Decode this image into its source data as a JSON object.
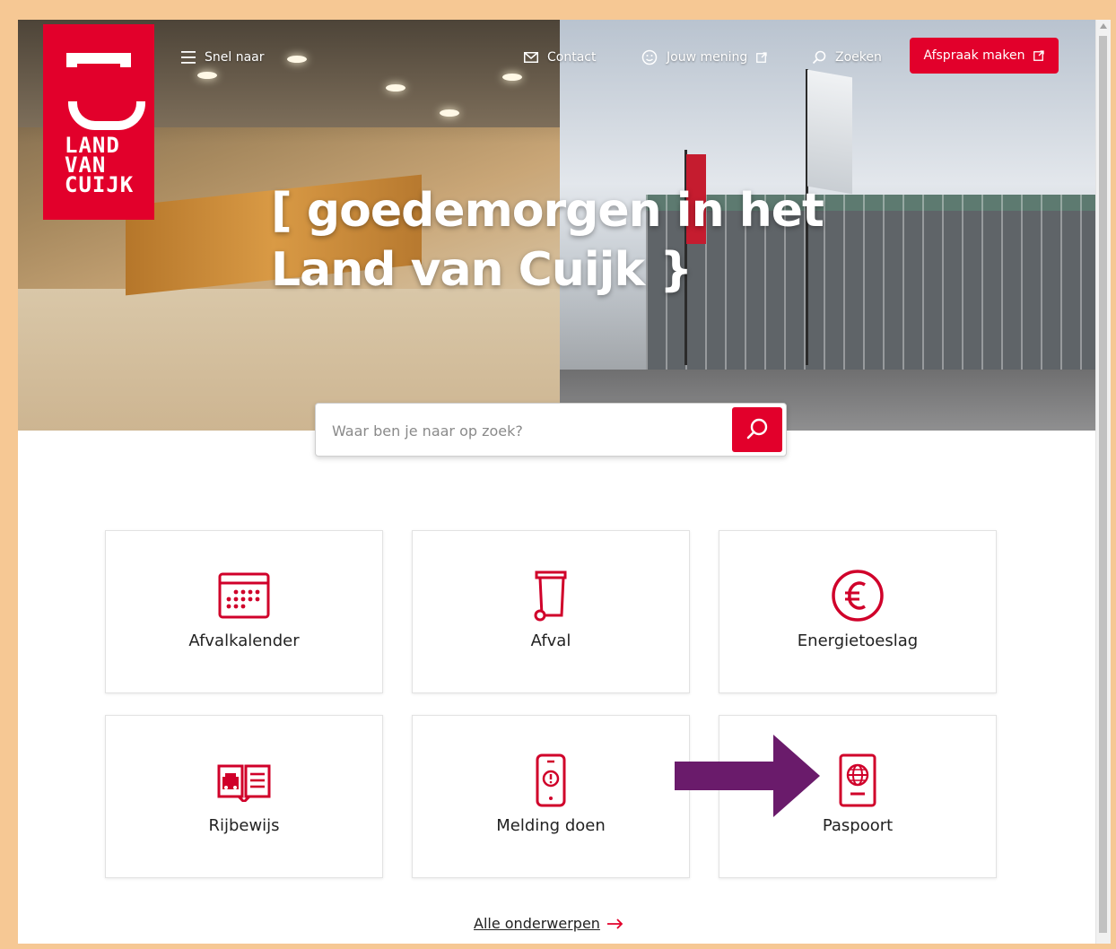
{
  "header": {
    "menu_label": "Snel naar",
    "contact_label": "Contact",
    "feedback_label": "Jouw mening",
    "search_label": "Zoeken",
    "cta_label": "Afspraak maken"
  },
  "logo": {
    "line1": "LAND",
    "line2": "VAN",
    "line3": "CUIJK"
  },
  "hero": {
    "title_line1": "[ goedemorgen in het",
    "title_line2": "Land van Cuijk }"
  },
  "search": {
    "placeholder": "Waar ben je naar op zoek?"
  },
  "tiles": [
    {
      "label": "Afvalkalender",
      "icon": "calendar-icon"
    },
    {
      "label": "Afval",
      "icon": "waste-bin-icon"
    },
    {
      "label": "Energietoeslag",
      "icon": "euro-icon"
    },
    {
      "label": "Rijbewijs",
      "icon": "drivers-license-icon"
    },
    {
      "label": "Melding doen",
      "icon": "phone-alert-icon"
    },
    {
      "label": "Paspoort",
      "icon": "passport-icon"
    }
  ],
  "annotation": {
    "icon": "arrow-right-icon",
    "color": "#6a1b6b"
  },
  "footer_link": {
    "label": "Alle onderwerpen"
  },
  "colors": {
    "brand": "#e2002b",
    "frame": "#f6c894"
  }
}
